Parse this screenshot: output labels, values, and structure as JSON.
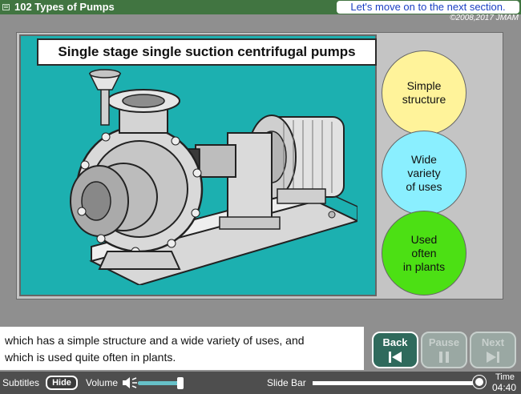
{
  "header": {
    "title": "102  Types of Pumps",
    "next_section": "Let's move on to the next section.",
    "copyright": "©2008,2017 JMAM"
  },
  "slide": {
    "title": "Single stage single suction centrifugal pumps",
    "image": "centrifugal-pump-illustration",
    "features": [
      {
        "label": "Simple\nstructure",
        "color": "#fff39a"
      },
      {
        "label": "Wide\nvariety\nof uses",
        "color": "#8aefff"
      },
      {
        "label": "Used\noften\nin plants",
        "color": "#4ce014"
      }
    ]
  },
  "subtitles": {
    "line1": "which has a simple structure and a wide variety of uses, and",
    "line2": "which is used quite often in plants."
  },
  "nav": {
    "back": {
      "label": "Back",
      "icon": "skip-back-icon",
      "enabled": true
    },
    "pause": {
      "label": "Pause",
      "icon": "pause-icon",
      "enabled": false
    },
    "next": {
      "label": "Next",
      "icon": "skip-next-icon",
      "enabled": false
    }
  },
  "controls": {
    "subtitles_label": "Subtitles",
    "hide_button": "Hide",
    "volume_label": "Volume",
    "volume_level": 0.9,
    "slide_bar_label": "Slide Bar",
    "slide_progress": 0.97,
    "time_label": "Time",
    "time_value": "04:40"
  },
  "colors": {
    "title_bar": "#417541",
    "panel": "#1cb0b0",
    "nav_active": "#2f6a5c",
    "banner_text": "#1b3fc4"
  }
}
